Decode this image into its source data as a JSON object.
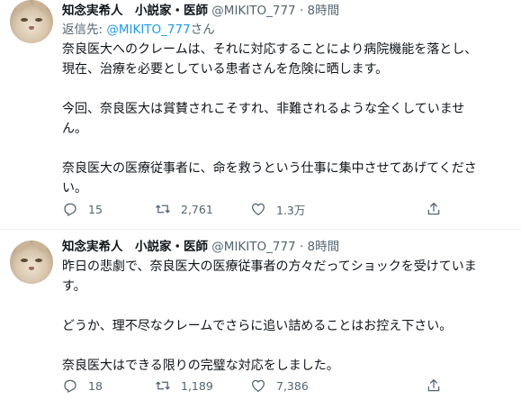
{
  "tweets": [
    {
      "author": {
        "name": "知念実希人　小説家・医師",
        "handle": "@MIKITO_777",
        "dot": "·",
        "time": "8時間"
      },
      "reply_to": {
        "label": "返信先: ",
        "mention": "@MIKITO_777",
        "suffix": "さん"
      },
      "body": {
        "p1_l1": "奈良医大へのクレームは、それに対応することにより病院機能を落とし、",
        "p1_l2": "現在、治療を必要としている患者さんを危険に晒します。",
        "p2_l1": "今回、奈良医大は賞賛されこそすれ、非難されるような全くしていませ",
        "p2_l2": "ん。",
        "p3_l1": "奈良医大の医療従事者に、命を救うという仕事に集中させてあげてくださ",
        "p3_l2": "い。"
      },
      "actions": {
        "replies": "15",
        "retweets": "2,761",
        "likes": "1.3万"
      }
    },
    {
      "author": {
        "name": "知念実希人　小説家・医師",
        "handle": "@MIKITO_777",
        "dot": "·",
        "time": "8時間"
      },
      "body": {
        "p1_l1": "昨日の悲劇で、奈良医大の医療従事者の方々だってショックを受けていま",
        "p1_l2": "す。",
        "p2_l1": "どうか、理不尽なクレームでさらに追い詰めることはお控え下さい。",
        "p3_l1": "奈良医大はできる限りの完璧な対応をしました。"
      },
      "actions": {
        "replies": "18",
        "retweets": "1,189",
        "likes": "7,386"
      }
    }
  ],
  "icons": {
    "reply": "reply-icon",
    "retweet": "retweet-icon",
    "like": "heart-icon",
    "share": "share-icon"
  },
  "colors": {
    "link": "#1d9bf0",
    "secondary_text": "#536471",
    "primary_text": "#0f1419"
  }
}
